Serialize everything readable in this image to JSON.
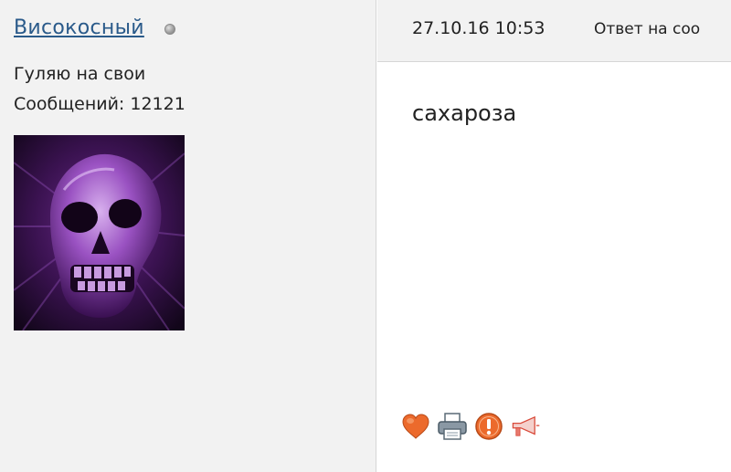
{
  "user": {
    "name": "Високосный",
    "status_text": "Гуляю на свои",
    "posts": "Сообщений: 12121"
  },
  "message": {
    "date": "27.10.16 10:53",
    "reply_label": "Ответ на соо",
    "body": "сахароза"
  },
  "actions": [
    {
      "icon": "heart-icon",
      "color": "#e8652a"
    },
    {
      "icon": "printer-icon",
      "color": "#6a7a86"
    },
    {
      "icon": "warning-icon",
      "color": "#e8652a"
    },
    {
      "icon": "megaphone-icon",
      "color": "#d94a3a"
    }
  ],
  "colors": {
    "username": "#2a5a8a",
    "panel_bg": "#f2f2f2",
    "avatar_tint": "#8a3fb0"
  }
}
